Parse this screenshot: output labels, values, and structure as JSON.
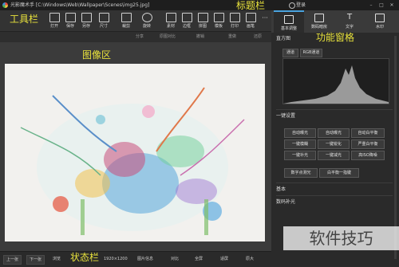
{
  "window": {
    "title": "光影魔术手  [C:\\Windows\\Web\\Wallpaper\\Scenes\\img25.jpg]",
    "login": "登录"
  },
  "toolbar": {
    "items": [
      {
        "label": "打开"
      },
      {
        "label": "保存"
      },
      {
        "label": "另存"
      },
      {
        "label": "尺寸"
      },
      {
        "label": "裁剪"
      },
      {
        "label": "旋转"
      },
      {
        "label": "素材"
      },
      {
        "label": "边框"
      },
      {
        "label": "拼图"
      },
      {
        "label": "模板"
      },
      {
        "label": "打印"
      },
      {
        "label": "画笔"
      }
    ]
  },
  "subbar": {
    "share": "分享",
    "compare": "原图对比",
    "undo": "撤销",
    "redo": "重做",
    "restore": "还原"
  },
  "panel": {
    "tabs": [
      {
        "label": "基本调整",
        "active": true
      },
      {
        "label": "数码暗房",
        "active": false
      },
      {
        "label": "文字",
        "active": false
      },
      {
        "label": "水印",
        "active": false
      }
    ],
    "histogram": {
      "title": "直方图",
      "channels": [
        "通道",
        "RGB通道"
      ]
    },
    "onekey": {
      "title": "一键设置",
      "buttons": [
        "自动曝光",
        "自动曝光",
        "自动白平衡",
        "一键模糊",
        "一键锐化",
        "严重白平衡",
        "一键补光",
        "一键减光",
        "高ISO降噪"
      ],
      "wide_buttons": [
        "数字点测光",
        "白平衡一指键"
      ]
    },
    "sections": [
      "基本",
      "数码补光"
    ]
  },
  "statusbar": {
    "prev": "上一张",
    "next": "下一张",
    "browse": "浏览",
    "size": "1920×1200",
    "info": "图片信息",
    "compare": "对比",
    "fullscreen": "全屏",
    "fit": "适屏",
    "original": "原大"
  },
  "annotations": {
    "titlebar": "标题栏",
    "toolbar": "工具栏",
    "image_area": "图像区",
    "function_pane": "功能窗格",
    "statusbar": "状态栏"
  },
  "watermark": "软件技巧",
  "colors": {
    "accent": "#4aa3df",
    "annotation": "#e8e23c"
  }
}
